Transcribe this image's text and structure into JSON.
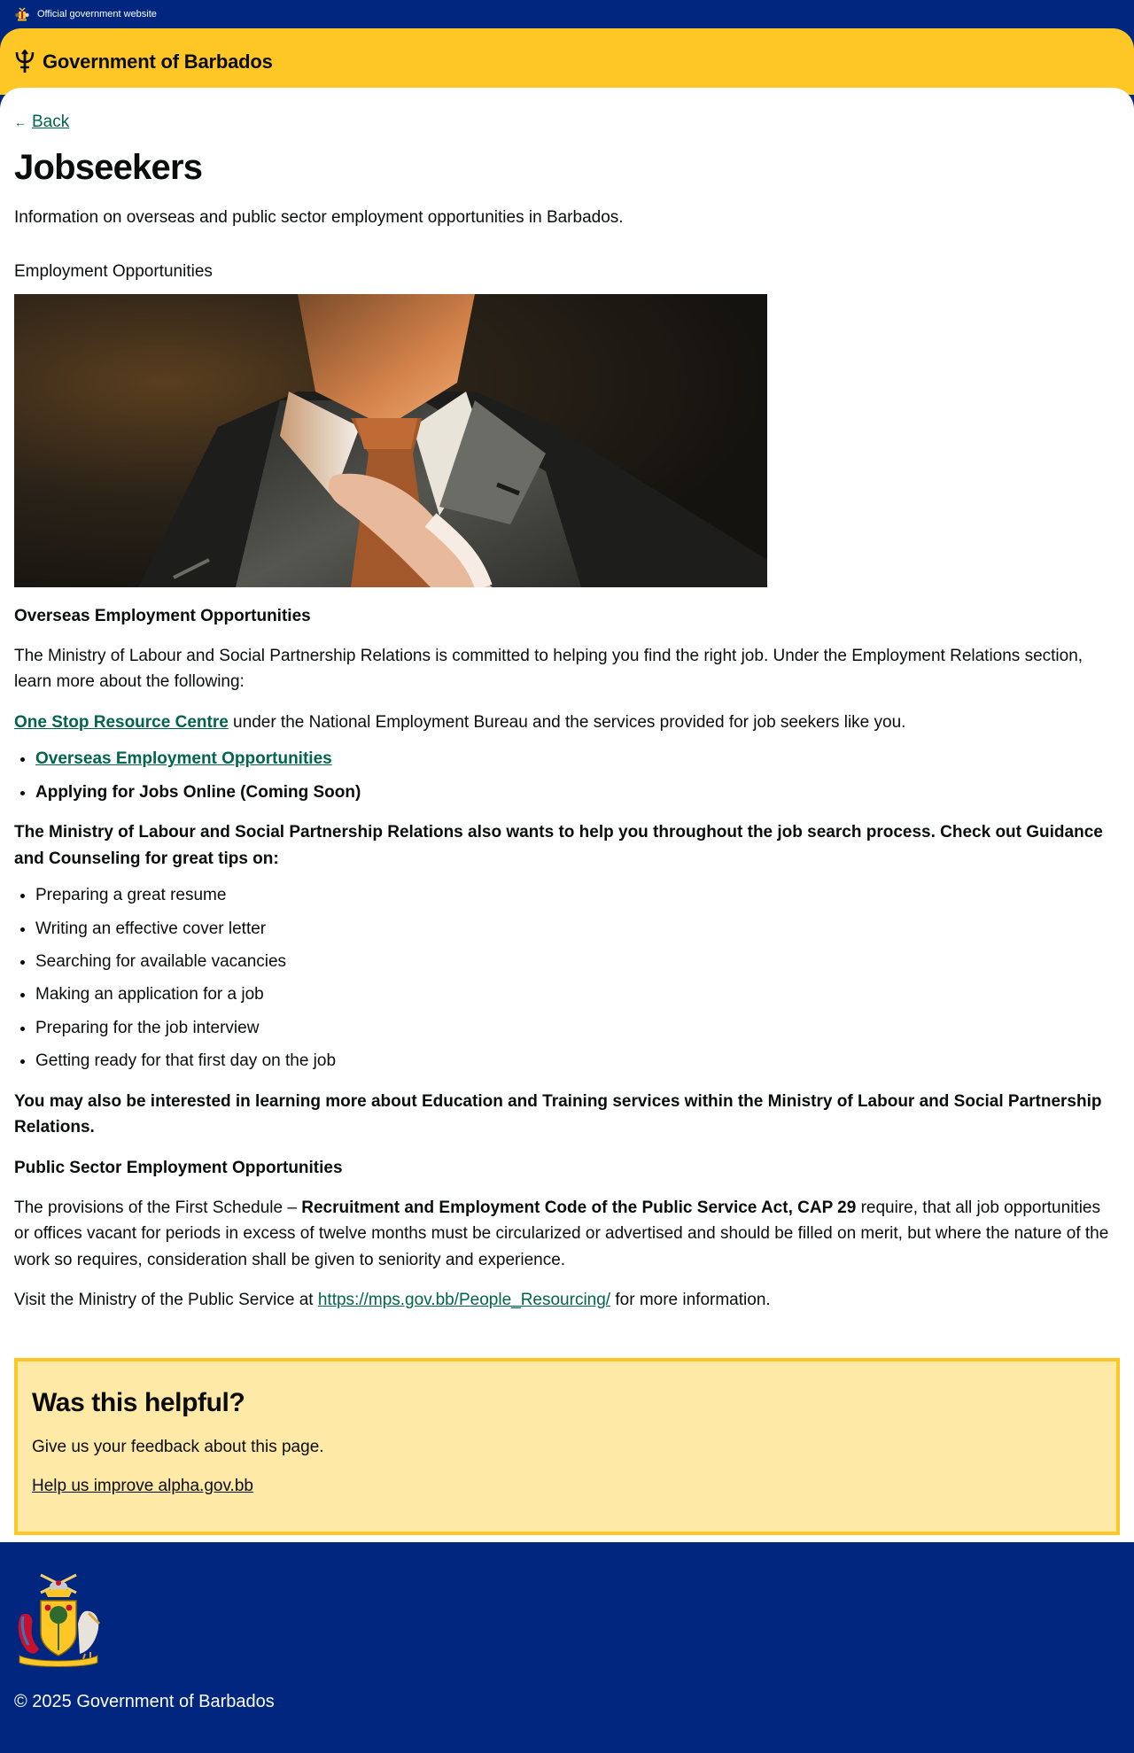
{
  "official_bar": {
    "text": "Official government website",
    "crest_icon": "coat-of-arms-icon"
  },
  "header": {
    "brand": "Government of Barbados",
    "logo_icon": "trident-icon",
    "color": "#ffc726"
  },
  "nav": {
    "back_label": "Back",
    "back_icon": "arrow-left-icon"
  },
  "page": {
    "title": "Jobseekers",
    "lead": "Information on overseas and public sector employment opportunities in Barbados.",
    "section_label": "Employment Opportunities"
  },
  "overseas": {
    "heading": "Overseas Employment Opportunities",
    "intro": "The Ministry of Labour and Social Partnership Relations is committed to helping you find the right job. Under the Employment Relations section, learn more about the following:",
    "one_stop_link": "One Stop Resource Centre",
    "one_stop_rest": " under the National Employment Bureau and the services provided for job seekers like you.",
    "list": {
      "item1_link": "Overseas Employment Opportunities",
      "item2": "Applying for Jobs Online (Coming Soon)"
    },
    "guidance": "The Ministry of Labour and Social Partnership Relations also wants to help you throughout the job search process. Check out Guidance and Counseling for great tips on:",
    "tips": [
      "Preparing a great resume",
      "Writing an effective cover letter",
      "Searching for available vacancies",
      "Making an application for a job",
      "Preparing for the job interview",
      "Getting ready for that first day on the job"
    ],
    "education_note": "You may also be interested in learning more about Education and Training services within the Ministry of Labour and Social Partnership Relations."
  },
  "public_sector": {
    "heading": "Public Sector Employment Opportunities",
    "provisions_start": "The provisions of the First Schedule – ",
    "provisions_bold": "Recruitment and Employment Code of the Public Service Act, CAP 29",
    "provisions_end": " require, that all job opportunities or offices vacant for periods in excess of twelve months must be circularized or advertised and should be filled on merit, but where the nature of the work so requires, consideration shall be given to seniority and experience.",
    "visit_start": "Visit the Ministry of the Public Service at ",
    "visit_link": "https://mps.gov.bb/People_Resourcing/",
    "visit_end": " for more information."
  },
  "feedback": {
    "heading": "Was this helpful?",
    "text": "Give us your feedback about this page.",
    "link": "Help us improve alpha.gov.bb"
  },
  "footer": {
    "crest_icon": "coat-of-arms-icon",
    "copyright": "© 2025 Government of Barbados",
    "color": "#00267f"
  },
  "colors": {
    "link": "#00654a",
    "brand_blue": "#00267f",
    "brand_yellow": "#ffc726",
    "feedback_bg": "#ffe9a6"
  }
}
